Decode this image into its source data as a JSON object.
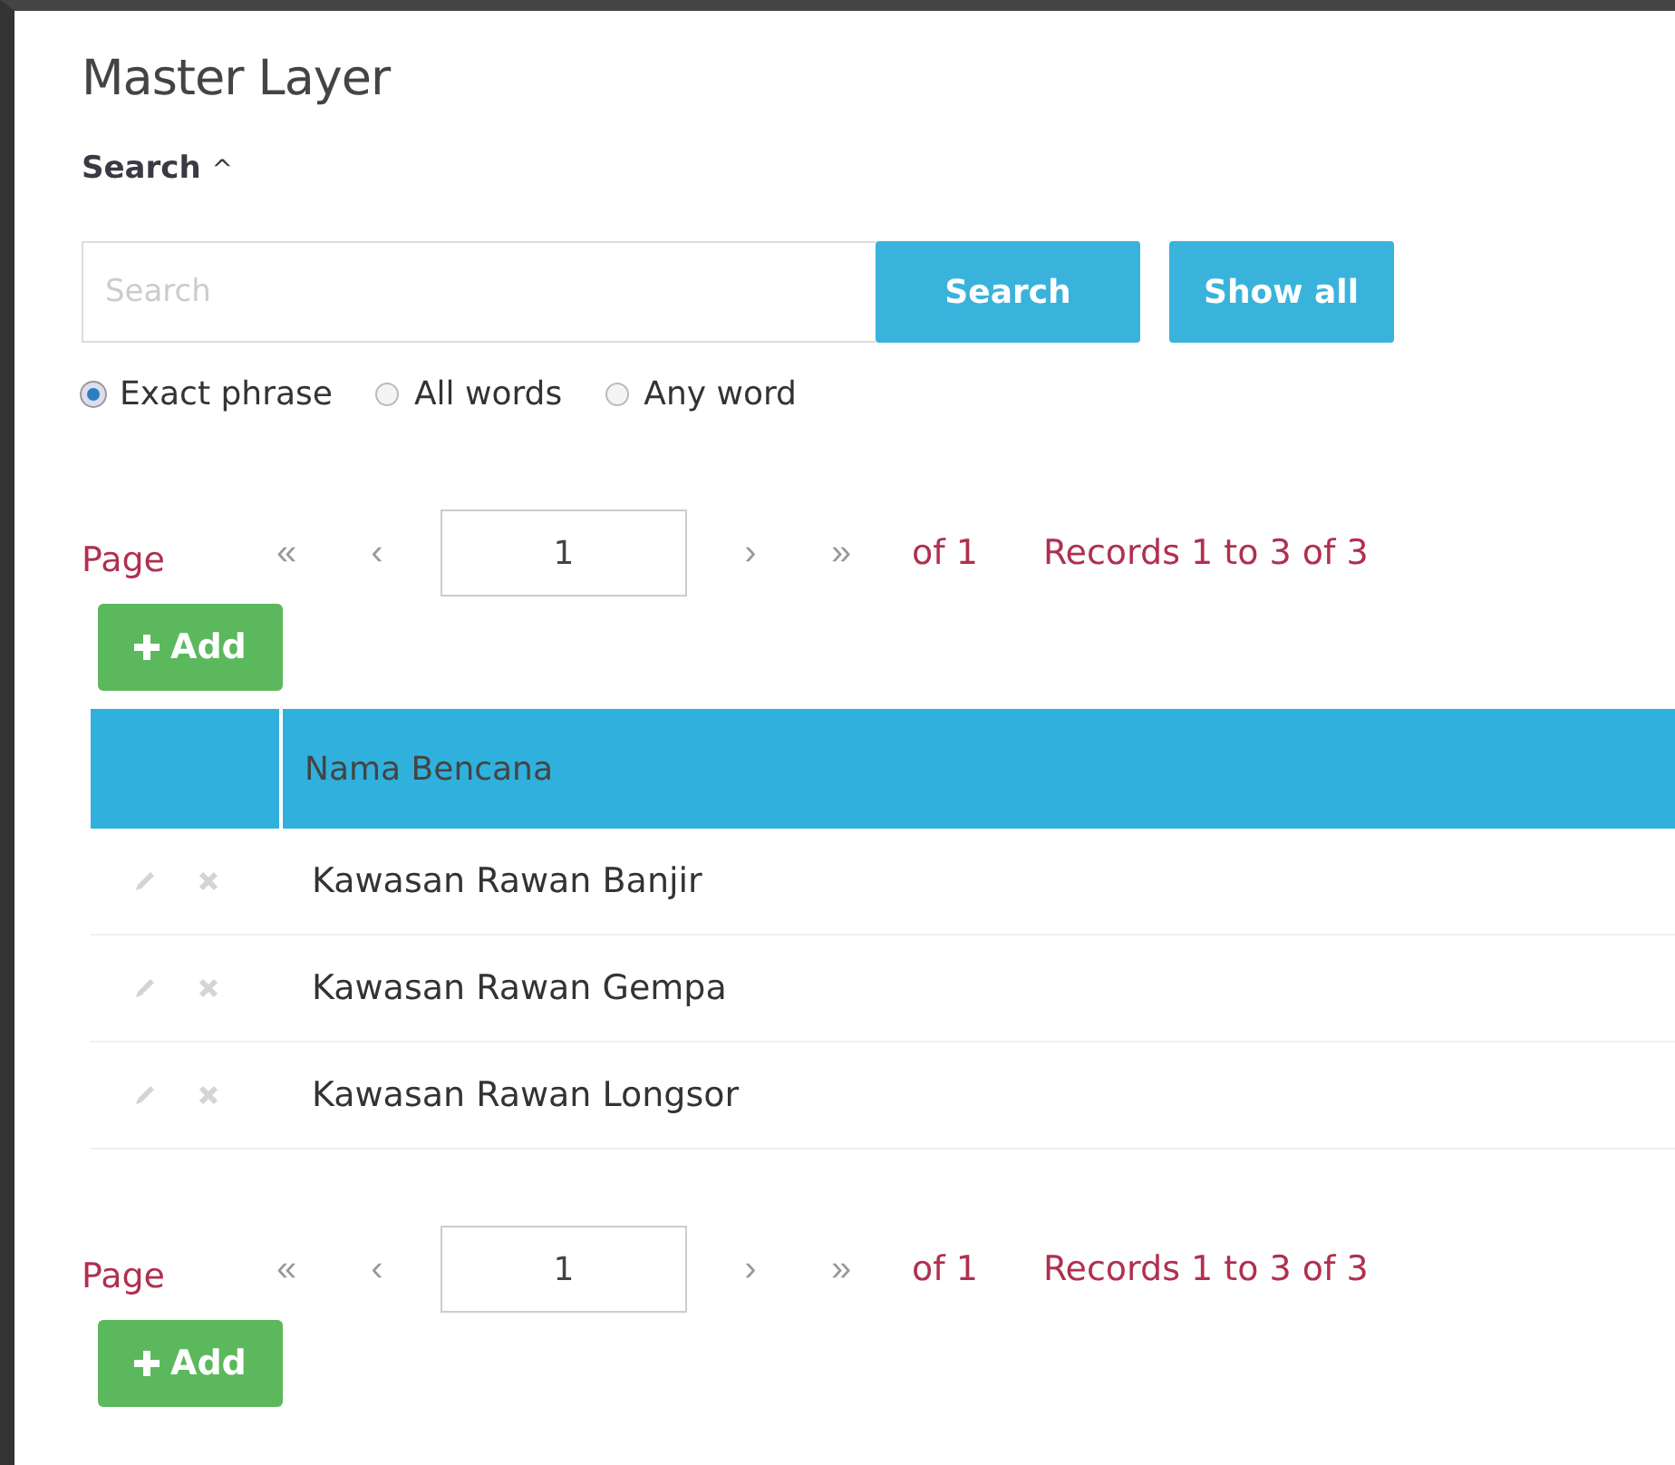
{
  "title": "Master Layer",
  "search": {
    "toggle_label": "Search",
    "toggle_icon": "^",
    "expanded": true,
    "placeholder": "Search",
    "button": "Search",
    "show_all": "Show all",
    "options": [
      {
        "label": "Exact phrase",
        "selected": true
      },
      {
        "label": "All words",
        "selected": false
      },
      {
        "label": "Any word",
        "selected": false
      }
    ]
  },
  "pager_top": {
    "label": "Page",
    "first": "«",
    "prev": "‹",
    "page": "1",
    "next": "›",
    "last": "»",
    "of": "of 1",
    "records": "Records 1 to 3 of 3",
    "add": "Add"
  },
  "table": {
    "columns": [
      "Nama Bencana"
    ],
    "rows": [
      {
        "name": "Kawasan Rawan Banjir"
      },
      {
        "name": "Kawasan Rawan Gempa"
      },
      {
        "name": "Kawasan Rawan Longsor"
      }
    ]
  },
  "pager_bottom": {
    "label": "Page",
    "first": "«",
    "prev": "‹",
    "page": "1",
    "next": "›",
    "last": "»",
    "of": "of 1",
    "records": "Records 1 to 3 of 3",
    "add": "Add"
  }
}
